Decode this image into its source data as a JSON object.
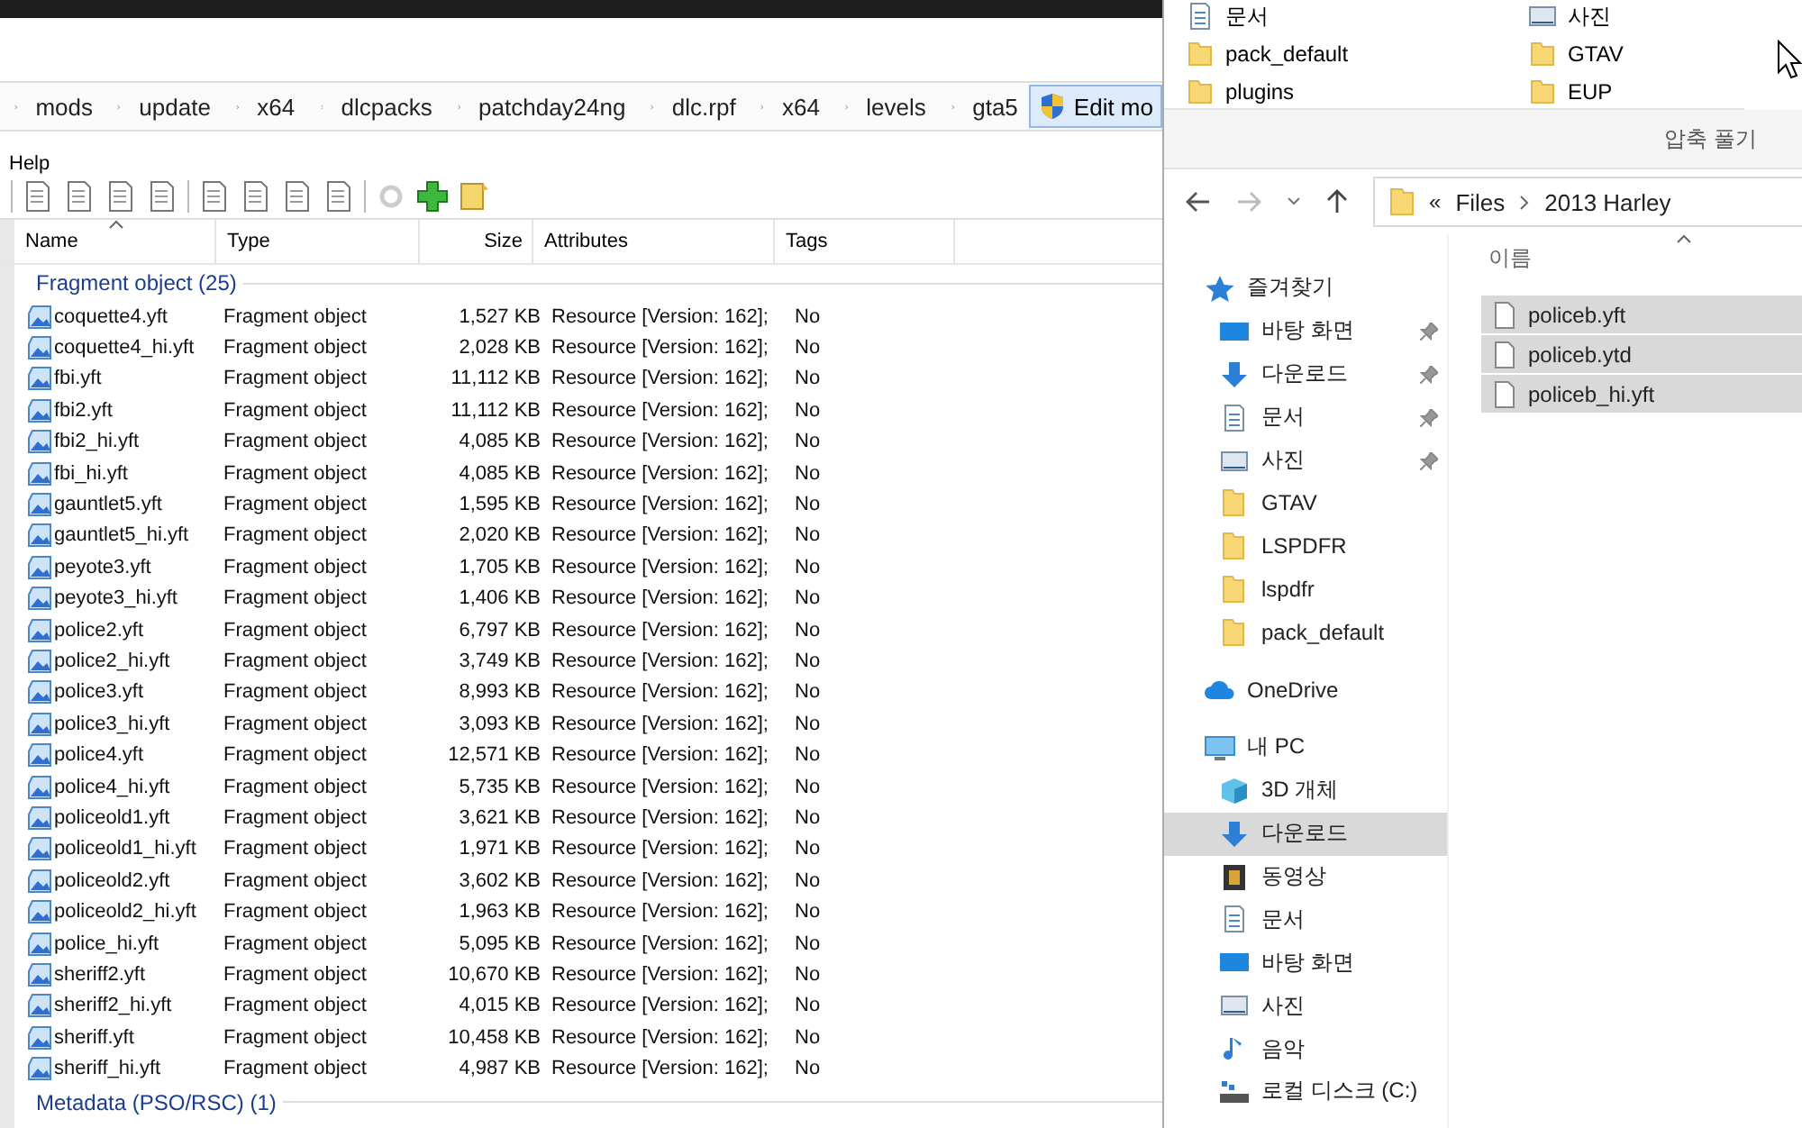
{
  "left_window": {
    "breadcrumb": [
      "mods",
      "update",
      "x64",
      "dlcpacks",
      "patchday24ng",
      "dlc.rpf",
      "x64",
      "levels",
      "gta5"
    ],
    "edit_button": "Edit mo",
    "menu": [
      "Help"
    ],
    "table": {
      "columns": [
        "Name",
        "Type",
        "Size",
        "Attributes",
        "Tags"
      ],
      "groups": [
        {
          "title": "Fragment object (25)",
          "rows": [
            {
              "name": "coquette4.yft",
              "type": "Fragment object",
              "size": "1,527 KB",
              "attributes": "Resource [Version: 162];",
              "tags": "No"
            },
            {
              "name": "coquette4_hi.yft",
              "type": "Fragment object",
              "size": "2,028 KB",
              "attributes": "Resource [Version: 162];",
              "tags": "No"
            },
            {
              "name": "fbi.yft",
              "type": "Fragment object",
              "size": "11,112 KB",
              "attributes": "Resource [Version: 162];",
              "tags": "No"
            },
            {
              "name": "fbi2.yft",
              "type": "Fragment object",
              "size": "11,112 KB",
              "attributes": "Resource [Version: 162];",
              "tags": "No"
            },
            {
              "name": "fbi2_hi.yft",
              "type": "Fragment object",
              "size": "4,085 KB",
              "attributes": "Resource [Version: 162];",
              "tags": "No"
            },
            {
              "name": "fbi_hi.yft",
              "type": "Fragment object",
              "size": "4,085 KB",
              "attributes": "Resource [Version: 162];",
              "tags": "No"
            },
            {
              "name": "gauntlet5.yft",
              "type": "Fragment object",
              "size": "1,595 KB",
              "attributes": "Resource [Version: 162];",
              "tags": "No"
            },
            {
              "name": "gauntlet5_hi.yft",
              "type": "Fragment object",
              "size": "2,020 KB",
              "attributes": "Resource [Version: 162];",
              "tags": "No"
            },
            {
              "name": "peyote3.yft",
              "type": "Fragment object",
              "size": "1,705 KB",
              "attributes": "Resource [Version: 162];",
              "tags": "No"
            },
            {
              "name": "peyote3_hi.yft",
              "type": "Fragment object",
              "size": "1,406 KB",
              "attributes": "Resource [Version: 162];",
              "tags": "No"
            },
            {
              "name": "police2.yft",
              "type": "Fragment object",
              "size": "6,797 KB",
              "attributes": "Resource [Version: 162];",
              "tags": "No"
            },
            {
              "name": "police2_hi.yft",
              "type": "Fragment object",
              "size": "3,749 KB",
              "attributes": "Resource [Version: 162];",
              "tags": "No"
            },
            {
              "name": "police3.yft",
              "type": "Fragment object",
              "size": "8,993 KB",
              "attributes": "Resource [Version: 162];",
              "tags": "No"
            },
            {
              "name": "police3_hi.yft",
              "type": "Fragment object",
              "size": "3,093 KB",
              "attributes": "Resource [Version: 162];",
              "tags": "No"
            },
            {
              "name": "police4.yft",
              "type": "Fragment object",
              "size": "12,571 KB",
              "attributes": "Resource [Version: 162];",
              "tags": "No"
            },
            {
              "name": "police4_hi.yft",
              "type": "Fragment object",
              "size": "5,735 KB",
              "attributes": "Resource [Version: 162];",
              "tags": "No"
            },
            {
              "name": "policeold1.yft",
              "type": "Fragment object",
              "size": "3,621 KB",
              "attributes": "Resource [Version: 162];",
              "tags": "No"
            },
            {
              "name": "policeold1_hi.yft",
              "type": "Fragment object",
              "size": "1,971 KB",
              "attributes": "Resource [Version: 162];",
              "tags": "No"
            },
            {
              "name": "policeold2.yft",
              "type": "Fragment object",
              "size": "3,602 KB",
              "attributes": "Resource [Version: 162];",
              "tags": "No"
            },
            {
              "name": "policeold2_hi.yft",
              "type": "Fragment object",
              "size": "1,963 KB",
              "attributes": "Resource [Version: 162];",
              "tags": "No"
            },
            {
              "name": "police_hi.yft",
              "type": "Fragment object",
              "size": "5,095 KB",
              "attributes": "Resource [Version: 162];",
              "tags": "No"
            },
            {
              "name": "sheriff2.yft",
              "type": "Fragment object",
              "size": "10,670 KB",
              "attributes": "Resource [Version: 162];",
              "tags": "No"
            },
            {
              "name": "sheriff2_hi.yft",
              "type": "Fragment object",
              "size": "4,015 KB",
              "attributes": "Resource [Version: 162];",
              "tags": "No"
            },
            {
              "name": "sheriff.yft",
              "type": "Fragment object",
              "size": "10,458 KB",
              "attributes": "Resource [Version: 162];",
              "tags": "No"
            },
            {
              "name": "sheriff_hi.yft",
              "type": "Fragment object",
              "size": "4,987 KB",
              "attributes": "Resource [Version: 162];",
              "tags": "No"
            }
          ]
        },
        {
          "title": "Metadata (PSO/RSC) (1)"
        }
      ]
    }
  },
  "right_window": {
    "quick_items": [
      {
        "label": "문서",
        "kind": "document"
      },
      {
        "label": "사진",
        "kind": "picture"
      },
      {
        "label": "pack_default",
        "kind": "folder"
      },
      {
        "label": "GTAV",
        "kind": "folder"
      },
      {
        "label": "plugins",
        "kind": "folder"
      },
      {
        "label": "EUP",
        "kind": "folder"
      }
    ],
    "extract_label": "압축 풀기",
    "address": {
      "overflow": "«",
      "path": [
        "Files",
        "2013 Harley"
      ]
    },
    "sidebar": [
      {
        "label": "즐겨찾기",
        "kind": "star",
        "selected": false,
        "children": [
          {
            "label": "바탕 화면",
            "kind": "desktop",
            "selected": false,
            "pinned": true
          },
          {
            "label": "다운로드",
            "kind": "download",
            "selected": false,
            "pinned": true
          },
          {
            "label": "문서",
            "kind": "document",
            "selected": false,
            "pinned": true
          },
          {
            "label": "사진",
            "kind": "picture",
            "selected": false,
            "pinned": true
          },
          {
            "label": "GTAV",
            "kind": "folder",
            "selected": false,
            "pinned": false
          },
          {
            "label": "LSPDFR",
            "kind": "folder",
            "selected": false,
            "pinned": false
          },
          {
            "label": "lspdfr",
            "kind": "folder",
            "selected": false,
            "pinned": false
          },
          {
            "label": "pack_default",
            "kind": "folder",
            "selected": false,
            "pinned": false
          }
        ]
      },
      {
        "label": "OneDrive",
        "kind": "cloud",
        "selected": false
      },
      {
        "label": "내 PC",
        "kind": "pc",
        "selected": false,
        "children": [
          {
            "label": "3D 개체",
            "kind": "cube",
            "selected": false,
            "pinned": false
          },
          {
            "label": "다운로드",
            "kind": "download",
            "selected": true,
            "pinned": false
          },
          {
            "label": "동영상",
            "kind": "video",
            "selected": false,
            "pinned": false
          },
          {
            "label": "문서",
            "kind": "document",
            "selected": false,
            "pinned": false
          },
          {
            "label": "바탕 화면",
            "kind": "desktop",
            "selected": false,
            "pinned": false
          },
          {
            "label": "사진",
            "kind": "picture",
            "selected": false,
            "pinned": false
          },
          {
            "label": "음악",
            "kind": "music",
            "selected": false,
            "pinned": false
          },
          {
            "label": "로컬 디스크 (C:)",
            "kind": "drive",
            "selected": false,
            "pinned": false
          }
        ]
      }
    ],
    "column": "이름",
    "files": [
      {
        "name": "policeb.yft",
        "selected": true
      },
      {
        "name": "policeb.ytd",
        "selected": true
      },
      {
        "name": "policeb_hi.yft",
        "selected": true
      }
    ]
  }
}
